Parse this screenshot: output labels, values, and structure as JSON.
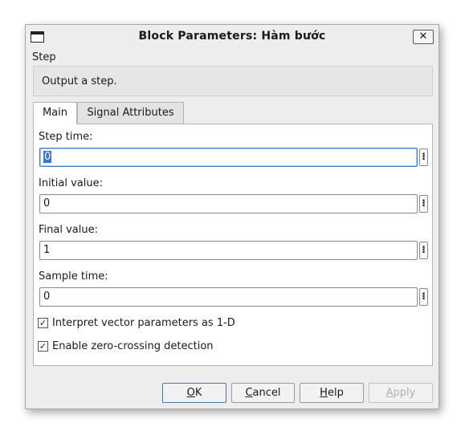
{
  "window": {
    "title": "Block Parameters: Hàm bước",
    "close_glyph": "✕"
  },
  "block": {
    "name": "Step",
    "description": "Output a step."
  },
  "tabs": [
    {
      "label": "Main",
      "active": true
    },
    {
      "label": "Signal Attributes",
      "active": false
    }
  ],
  "fields": [
    {
      "label": "Step time:",
      "value": "0",
      "focused": true
    },
    {
      "label": "Initial value:",
      "value": "0"
    },
    {
      "label": "Final value:",
      "value": "1"
    },
    {
      "label": "Sample time:",
      "value": "0"
    }
  ],
  "menu_glyph": "⁝",
  "checkboxes": [
    {
      "label": "Interpret vector parameters as 1-D",
      "checked": true
    },
    {
      "label": "Enable zero-crossing detection",
      "checked": true
    }
  ],
  "check_glyph": "✓",
  "buttons": {
    "ok": {
      "mnemonic": "O",
      "rest": "K"
    },
    "cancel": {
      "mnemonic": "C",
      "rest": "ancel"
    },
    "help": {
      "mnemonic": "H",
      "rest": "elp"
    },
    "apply": {
      "mnemonic": "A",
      "rest": "pply",
      "disabled": true
    }
  }
}
